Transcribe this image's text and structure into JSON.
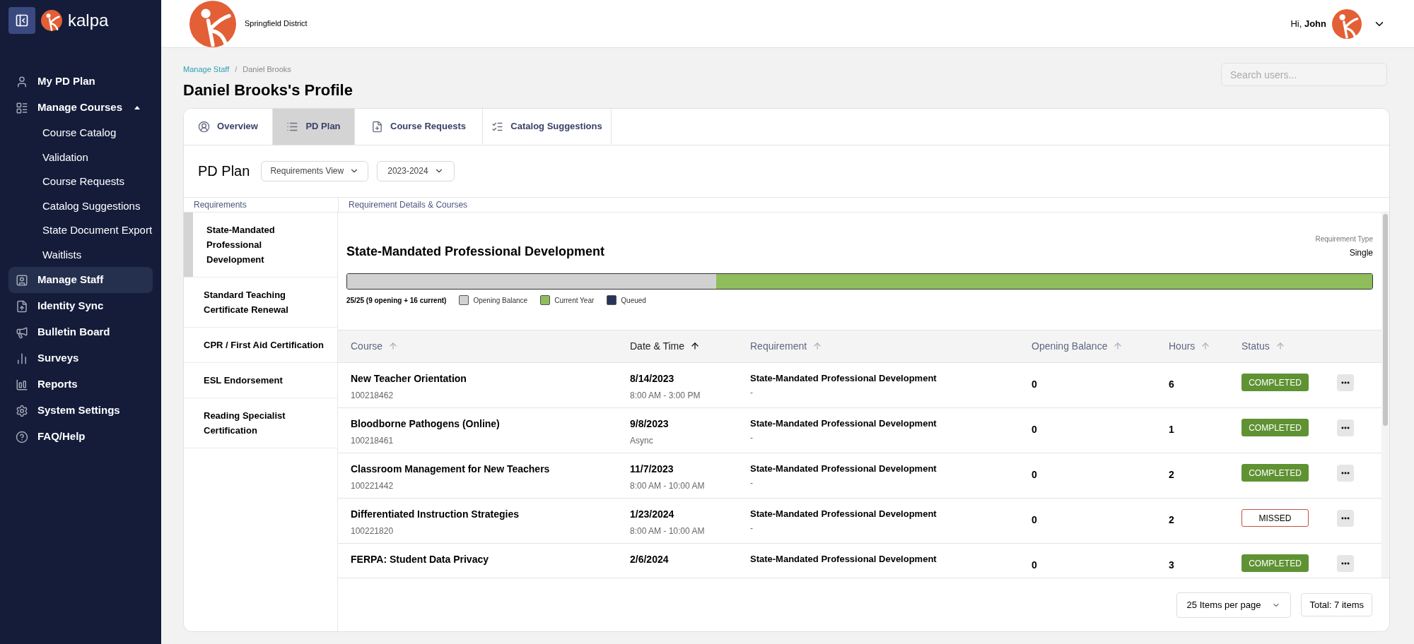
{
  "brand": "kalpa",
  "sidebar": {
    "items": [
      {
        "label": "My PD Plan",
        "selected": false
      },
      {
        "label": "Manage Courses",
        "selected": false,
        "expanded": true,
        "children": [
          {
            "label": "Course Catalog"
          },
          {
            "label": "Validation"
          },
          {
            "label": "Course Requests"
          },
          {
            "label": "Catalog Suggestions"
          },
          {
            "label": "State Document Export"
          },
          {
            "label": "Waitlists"
          }
        ]
      },
      {
        "label": "Manage Staff",
        "selected": true
      },
      {
        "label": "Identity Sync",
        "selected": false
      },
      {
        "label": "Bulletin Board",
        "selected": false
      },
      {
        "label": "Surveys",
        "selected": false
      },
      {
        "label": "Reports",
        "selected": false
      },
      {
        "label": "System Settings",
        "selected": false
      },
      {
        "label": "FAQ/Help",
        "selected": false
      }
    ]
  },
  "header": {
    "district": "Springfield District",
    "greeting": "Hi,",
    "user": "John"
  },
  "breadcrumb": [
    "Manage Staff",
    "/",
    "Daniel Brooks"
  ],
  "page_title": "Daniel Brooks's Profile",
  "search": {
    "placeholder": "Search users..."
  },
  "tabs": [
    {
      "label": "Overview",
      "selected": false
    },
    {
      "label": "PD Plan",
      "selected": true
    },
    {
      "label": "Course Requests",
      "selected": false
    },
    {
      "label": "Catalog Suggestions",
      "selected": false
    }
  ],
  "plan": {
    "title": "PD Plan",
    "view": "Requirements View",
    "year": "2023-2024"
  },
  "columns": {
    "left": "Requirements",
    "right": "Requirement Details & Courses"
  },
  "requirements": [
    {
      "label": "State-Mandated Professional Development",
      "selected": true
    },
    {
      "label": "Standard Teaching Certificate Renewal",
      "selected": false
    },
    {
      "label": "CPR / First Aid Certification",
      "selected": false
    },
    {
      "label": "ESL Endorsement",
      "selected": false
    },
    {
      "label": "Reading Specialist Certification",
      "selected": false
    }
  ],
  "detail": {
    "title": "State-Mandated Professional Development",
    "type_label": "Requirement Type",
    "type_value": "Single",
    "progress": {
      "summary": "25/25 (9 opening + 16 current)",
      "segments": [
        {
          "level": 0.36,
          "color": "#d1d1d1"
        },
        {
          "level": 0.64,
          "color": "#8fbd5c"
        }
      ],
      "legend": [
        {
          "label": "Opening Balance",
          "color": "#d1d1d1"
        },
        {
          "label": "Current Year",
          "color": "#8fbd5c"
        },
        {
          "label": "Queued",
          "color": "#283559"
        }
      ]
    }
  },
  "table": {
    "columns": [
      {
        "label": "Course",
        "sorted": false
      },
      {
        "label": "Date & Time",
        "sorted": true
      },
      {
        "label": "Requirement",
        "sorted": false
      },
      {
        "label": "Opening Balance",
        "sorted": false
      },
      {
        "label": "Hours",
        "sorted": false
      },
      {
        "label": "Status",
        "sorted": false
      }
    ],
    "rows": [
      {
        "course": "New Teacher Orientation",
        "id": "100218462",
        "date": "8/14/2023",
        "time": "8:00 AM - 3:00 PM",
        "requirement": "State-Mandated Professional Development",
        "requirement_note": "-",
        "opening": "0",
        "hours": "6",
        "status": {
          "label": "COMPLETED",
          "kind": "completed"
        }
      },
      {
        "course": "Bloodborne Pathogens (Online)",
        "id": "100218461",
        "date": "9/8/2023",
        "time": "Async",
        "requirement": "State-Mandated Professional Development",
        "requirement_note": "-",
        "opening": "0",
        "hours": "1",
        "status": {
          "label": "COMPLETED",
          "kind": "completed"
        }
      },
      {
        "course": "Classroom Management for New Teachers",
        "id": "100221442",
        "date": "11/7/2023",
        "time": "8:00 AM - 10:00 AM",
        "requirement": "State-Mandated Professional Development",
        "requirement_note": "-",
        "opening": "0",
        "hours": "2",
        "status": {
          "label": "COMPLETED",
          "kind": "completed"
        }
      },
      {
        "course": "Differentiated Instruction Strategies",
        "id": "100221820",
        "date": "1/23/2024",
        "time": "8:00 AM - 10:00 AM",
        "requirement": "State-Mandated Professional Development",
        "requirement_note": "-",
        "opening": "0",
        "hours": "2",
        "status": {
          "label": "MISSED",
          "kind": "missed"
        }
      },
      {
        "course": "FERPA: Student Data Privacy",
        "date": "2/6/2024",
        "requirement": "State-Mandated Professional Development",
        "opening": "0",
        "hours": "3",
        "status": {
          "label": "COMPLETED",
          "kind": "completed"
        }
      }
    ]
  },
  "pagination": {
    "per_page": "25 Items per page",
    "total": "Total: 7 items"
  }
}
